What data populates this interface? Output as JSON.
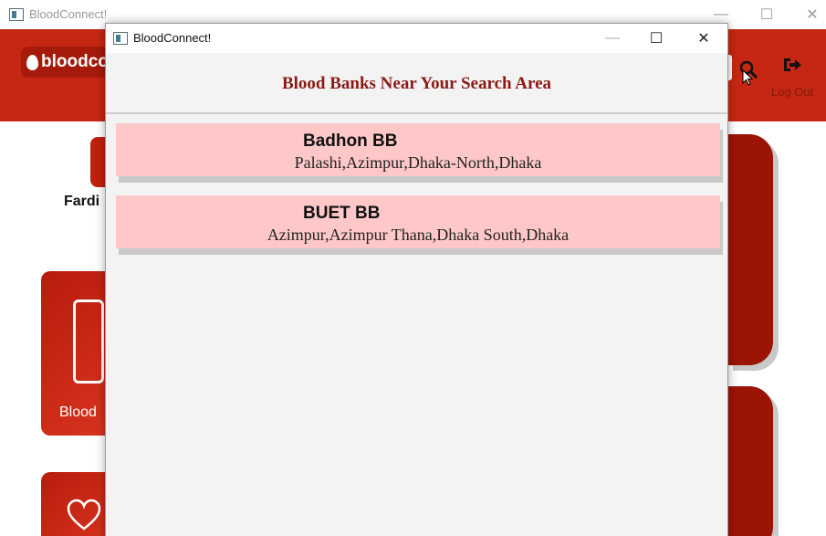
{
  "background_window": {
    "title": "BloodConnect!",
    "controls": {
      "minimize": "—",
      "maximize": "☐",
      "close": "✕"
    },
    "logo_text": "bloodco",
    "logout_label": "Log Out",
    "user_name_partial": "Fardi",
    "card_label_partial": "Blood",
    "colors": {
      "header": "#c62712",
      "card": "#b71c0c",
      "dark_card": "#9b1406"
    }
  },
  "dialog": {
    "title": "BloodConnect!",
    "controls": {
      "minimize": "—",
      "maximize": "☐",
      "close": "✕"
    },
    "heading": "Blood Banks Near Your Search Area",
    "banks": [
      {
        "name": "Badhon BB",
        "address": "Palashi,Azimpur,Dhaka-North,Dhaka"
      },
      {
        "name": "BUET BB",
        "address": "Azimpur,Azimpur Thana,Dhaka South,Dhaka"
      }
    ],
    "colors": {
      "heading": "#8b1a14",
      "card_bg": "#ffc8c8"
    }
  }
}
